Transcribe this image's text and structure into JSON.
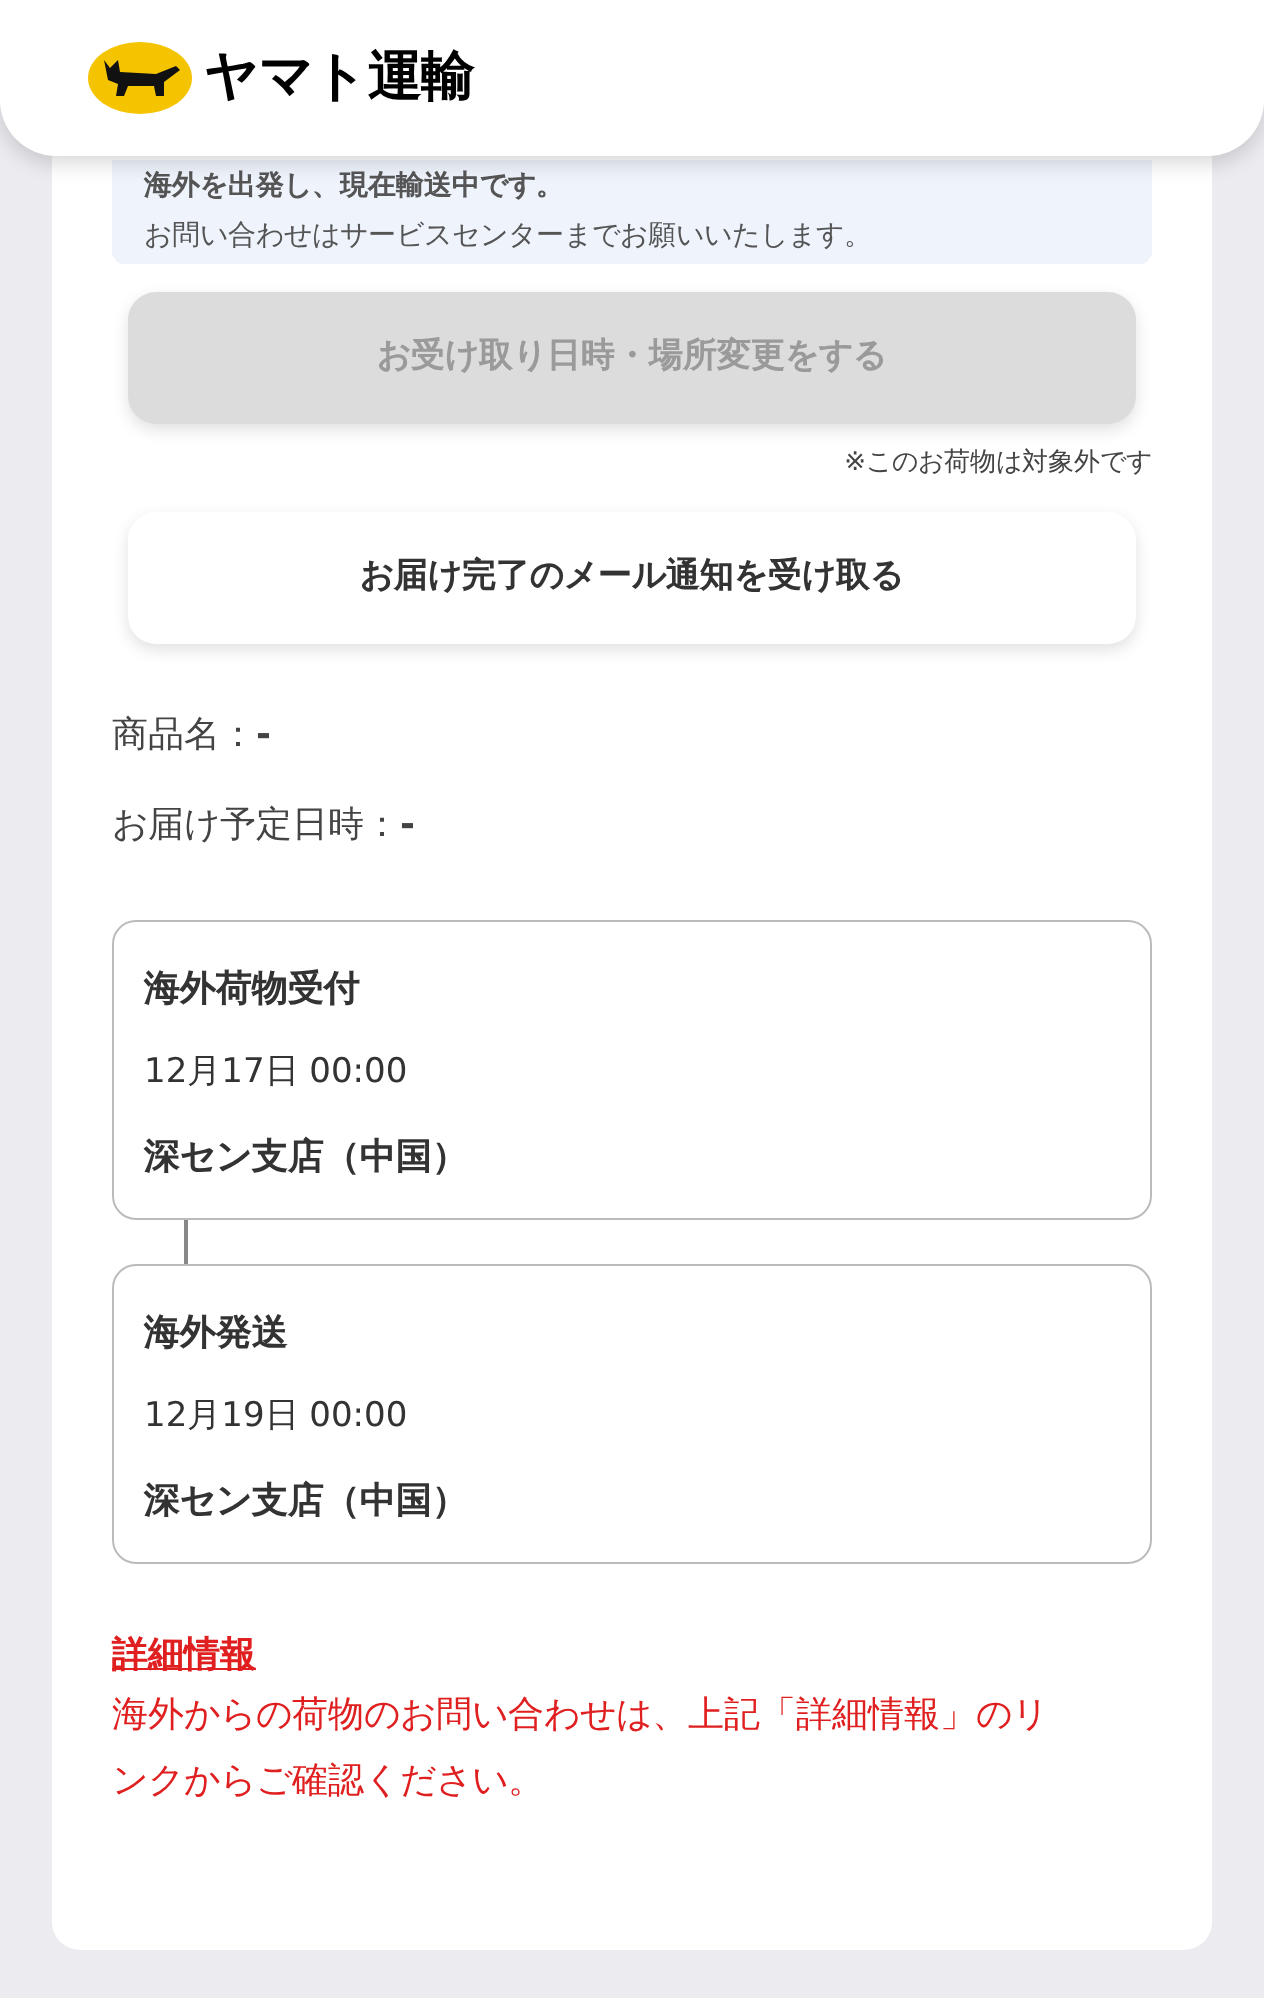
{
  "header": {
    "logo_text": "ヤマト運輸"
  },
  "notice": {
    "lines": [
      "海外を出発し、現在輸送中です。",
      "お問い合わせはサービスセンターまでお願いいたします。"
    ]
  },
  "actions": [
    {
      "label": "お受け取り日時・場所変更をする",
      "disabled": true,
      "note": "※このお荷物は対象外です"
    },
    {
      "label": "お届け完了のメール通知を受け取る",
      "disabled": false
    }
  ],
  "fields": [
    "商品名：**-**",
    "お届け予定日時：**-**"
  ],
  "timeline": [
    {
      "status": "海外荷物受付",
      "datetime": "12月17日 00:00",
      "location": "深セン支店（中国）"
    },
    {
      "status": "海外発送",
      "datetime": "12月19日 00:00",
      "location": "深セン支店（中国）"
    }
  ],
  "details": {
    "link": "詳細情報",
    "message": "海外からの荷物のお問い合わせは、上記「詳細情報」のリンクからご確認ください。"
  }
}
